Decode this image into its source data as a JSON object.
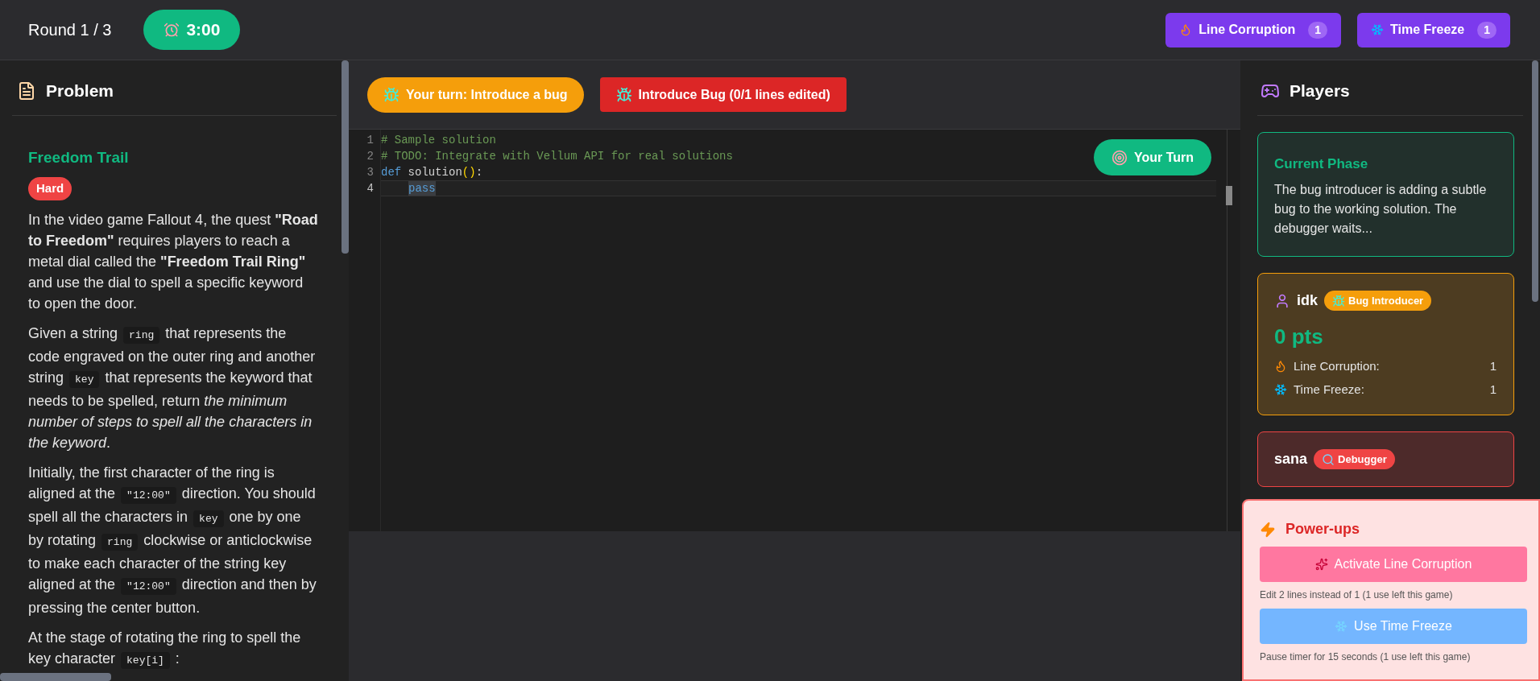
{
  "header": {
    "round": "Round 1 / 3",
    "timer": "3:00",
    "powerups": [
      {
        "kind": "fire",
        "label": "Line Corruption",
        "count": "1"
      },
      {
        "kind": "freeze",
        "label": "Time Freeze",
        "count": "1"
      }
    ]
  },
  "problem": {
    "heading": "Problem",
    "title": "Freedom Trail",
    "difficulty": "Hard",
    "paragraphs": [
      [
        {
          "kind": "text",
          "text": "In the video game Fallout 4, the quest **\"Road to Freedom\"** requires players to reach a metal dial called the **\"Freedom Trail Ring\"** and use the dial to spell a specific keyword to open the door."
        }
      ],
      [
        {
          "kind": "text",
          "text": "Given a string "
        },
        {
          "kind": "code",
          "text": "ring"
        },
        {
          "kind": "text",
          "text": " that represents the code engraved on the outer ring and another string "
        },
        {
          "kind": "code",
          "text": "key"
        },
        {
          "kind": "text",
          "text": " that represents the keyword that needs to be spelled, return *the minimum number of steps to spell all the characters in the keyword*."
        }
      ],
      [
        {
          "kind": "text",
          "text": "Initially, the first character of the ring is aligned at the "
        },
        {
          "kind": "code",
          "text": "\"12:00\""
        },
        {
          "kind": "text",
          "text": " direction. You should spell all the characters in "
        },
        {
          "kind": "code",
          "text": "key"
        },
        {
          "kind": "text",
          "text": " one by one by rotating "
        },
        {
          "kind": "code",
          "text": "ring"
        },
        {
          "kind": "text",
          "text": " clockwise or anticlockwise to make each character of the string key aligned at the "
        },
        {
          "kind": "code",
          "text": "\"12:00\""
        },
        {
          "kind": "text",
          "text": " direction and then by pressing the center button."
        }
      ],
      [
        {
          "kind": "text",
          "text": "At the stage of rotating the ring to spell the key character "
        },
        {
          "kind": "code",
          "text": "key[i]"
        },
        {
          "kind": "text",
          "text": " :"
        }
      ]
    ]
  },
  "editor": {
    "status": "Your turn: Introduce a bug",
    "action": "Introduce Bug (0/1 lines edited)",
    "turn_badge": "Your Turn",
    "lines": [
      {
        "number": "1",
        "current": false,
        "indented": false,
        "tokens": [
          {
            "kind": "comment",
            "text": "# Sample solution",
            "highlighted": false
          }
        ]
      },
      {
        "number": "2",
        "current": false,
        "indented": false,
        "tokens": [
          {
            "kind": "comment",
            "text": "# TODO: Integrate with Vellum API for real solutions",
            "highlighted": false
          }
        ]
      },
      {
        "number": "3",
        "current": false,
        "indented": false,
        "tokens": [
          {
            "kind": "keyword",
            "text": "def",
            "highlighted": false
          },
          {
            "kind": "plain",
            "text": "solution",
            "highlighted": false
          },
          {
            "kind": "paren",
            "text": "()",
            "highlighted": false
          },
          {
            "kind": "plain",
            "text": ":",
            "highlighted": false
          }
        ]
      },
      {
        "number": "4",
        "current": true,
        "indented": true,
        "tokens": [
          {
            "kind": "keyword",
            "text": "pass",
            "highlighted": true
          }
        ]
      }
    ]
  },
  "players": {
    "heading": "Players",
    "phase": {
      "title": "Current Phase",
      "text": "The bug introducer is adding a subtle bug to the working solution. The debugger waits..."
    },
    "list": [
      {
        "kind": "introducer",
        "name": "idk",
        "role": "Bug Introducer",
        "points": "0 pts",
        "stats": [
          {
            "kind": "fire",
            "label": "Line Corruption:",
            "value": "1"
          },
          {
            "kind": "freeze",
            "label": "Time Freeze:",
            "value": "1"
          }
        ]
      },
      {
        "kind": "debugger",
        "name": "sana",
        "role": "Debugger"
      }
    ]
  },
  "powerups_panel": {
    "title": "Power-ups",
    "items": [
      {
        "kind": "fire",
        "button": "Activate Line Corruption",
        "note": "Edit 2 lines instead of 1 (1 use left this game)"
      },
      {
        "kind": "freeze",
        "button": "Use Time Freeze",
        "note": "Pause timer for 15 seconds (1 use left this game)"
      }
    ]
  }
}
